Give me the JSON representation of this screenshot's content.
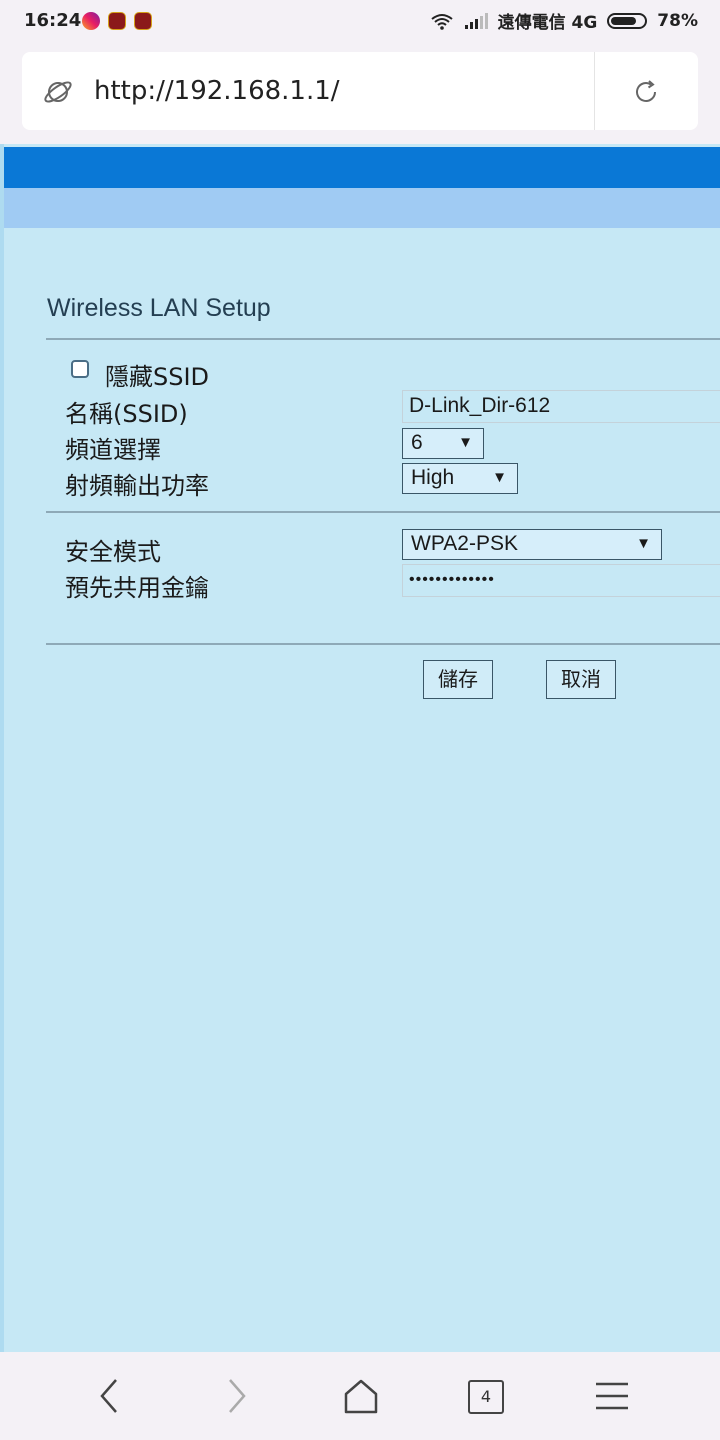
{
  "status_bar": {
    "time": "16:24",
    "carrier": "遠傳電信 4G",
    "battery": "78%",
    "battery_level": 0.78,
    "icons": [
      "instagram-icon",
      "game-app-icon",
      "game-app-icon",
      "wifi-icon",
      "signal-icon",
      "battery-icon"
    ]
  },
  "browser": {
    "url": "http://192.168.1.1/",
    "tab_count": "4"
  },
  "page": {
    "title": "Wireless LAN Setup",
    "hide_ssid_label": "隱藏SSID",
    "hide_ssid_checked": false,
    "ssid_label": "名稱(SSID)",
    "ssid_value": "D-Link_Dir-612",
    "channel_label": "頻道選擇",
    "channel_value": "6",
    "power_label": "射頻輸出功率",
    "power_value": "High",
    "security_label": "安全模式",
    "security_value": "WPA2-PSK",
    "psk_label": "預先共用金鑰",
    "psk_value": "•••••••••••••",
    "save_button": "儲存",
    "cancel_button": "取消"
  },
  "colors": {
    "page_background": "#c6e8f5",
    "header_bar": "#0a78d6",
    "sub_header_bar": "#a0cbf3"
  }
}
